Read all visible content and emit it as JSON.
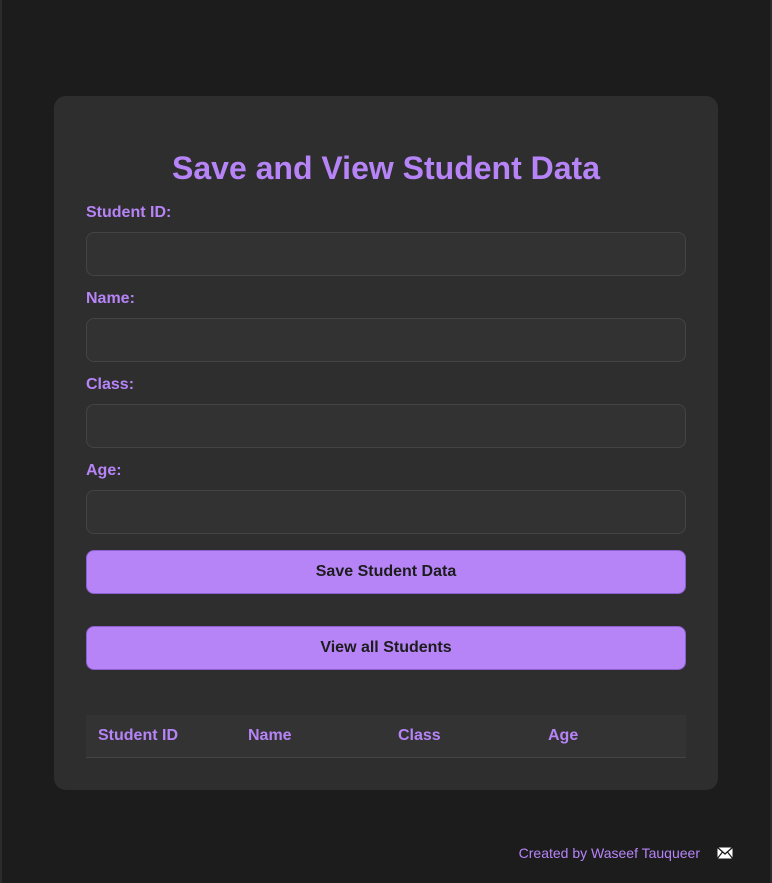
{
  "form": {
    "title": "Save and View Student Data",
    "fields": [
      {
        "label": "Student ID:",
        "value": "",
        "placeholder": ""
      },
      {
        "label": "Name:",
        "value": "",
        "placeholder": ""
      },
      {
        "label": "Class:",
        "value": "",
        "placeholder": ""
      },
      {
        "label": "Age:",
        "value": "",
        "placeholder": ""
      }
    ],
    "save_button": "Save Student Data",
    "view_button": "View all Students"
  },
  "table": {
    "headers": [
      "Student ID",
      "Name",
      "Class",
      "Age"
    ],
    "rows": []
  },
  "footer": {
    "text": "Created by Waseef Tauqueer",
    "icon": "mail-icon"
  },
  "colors": {
    "accent": "#b784f8",
    "background": "#1c1c1c",
    "card": "#2e2e2e"
  }
}
